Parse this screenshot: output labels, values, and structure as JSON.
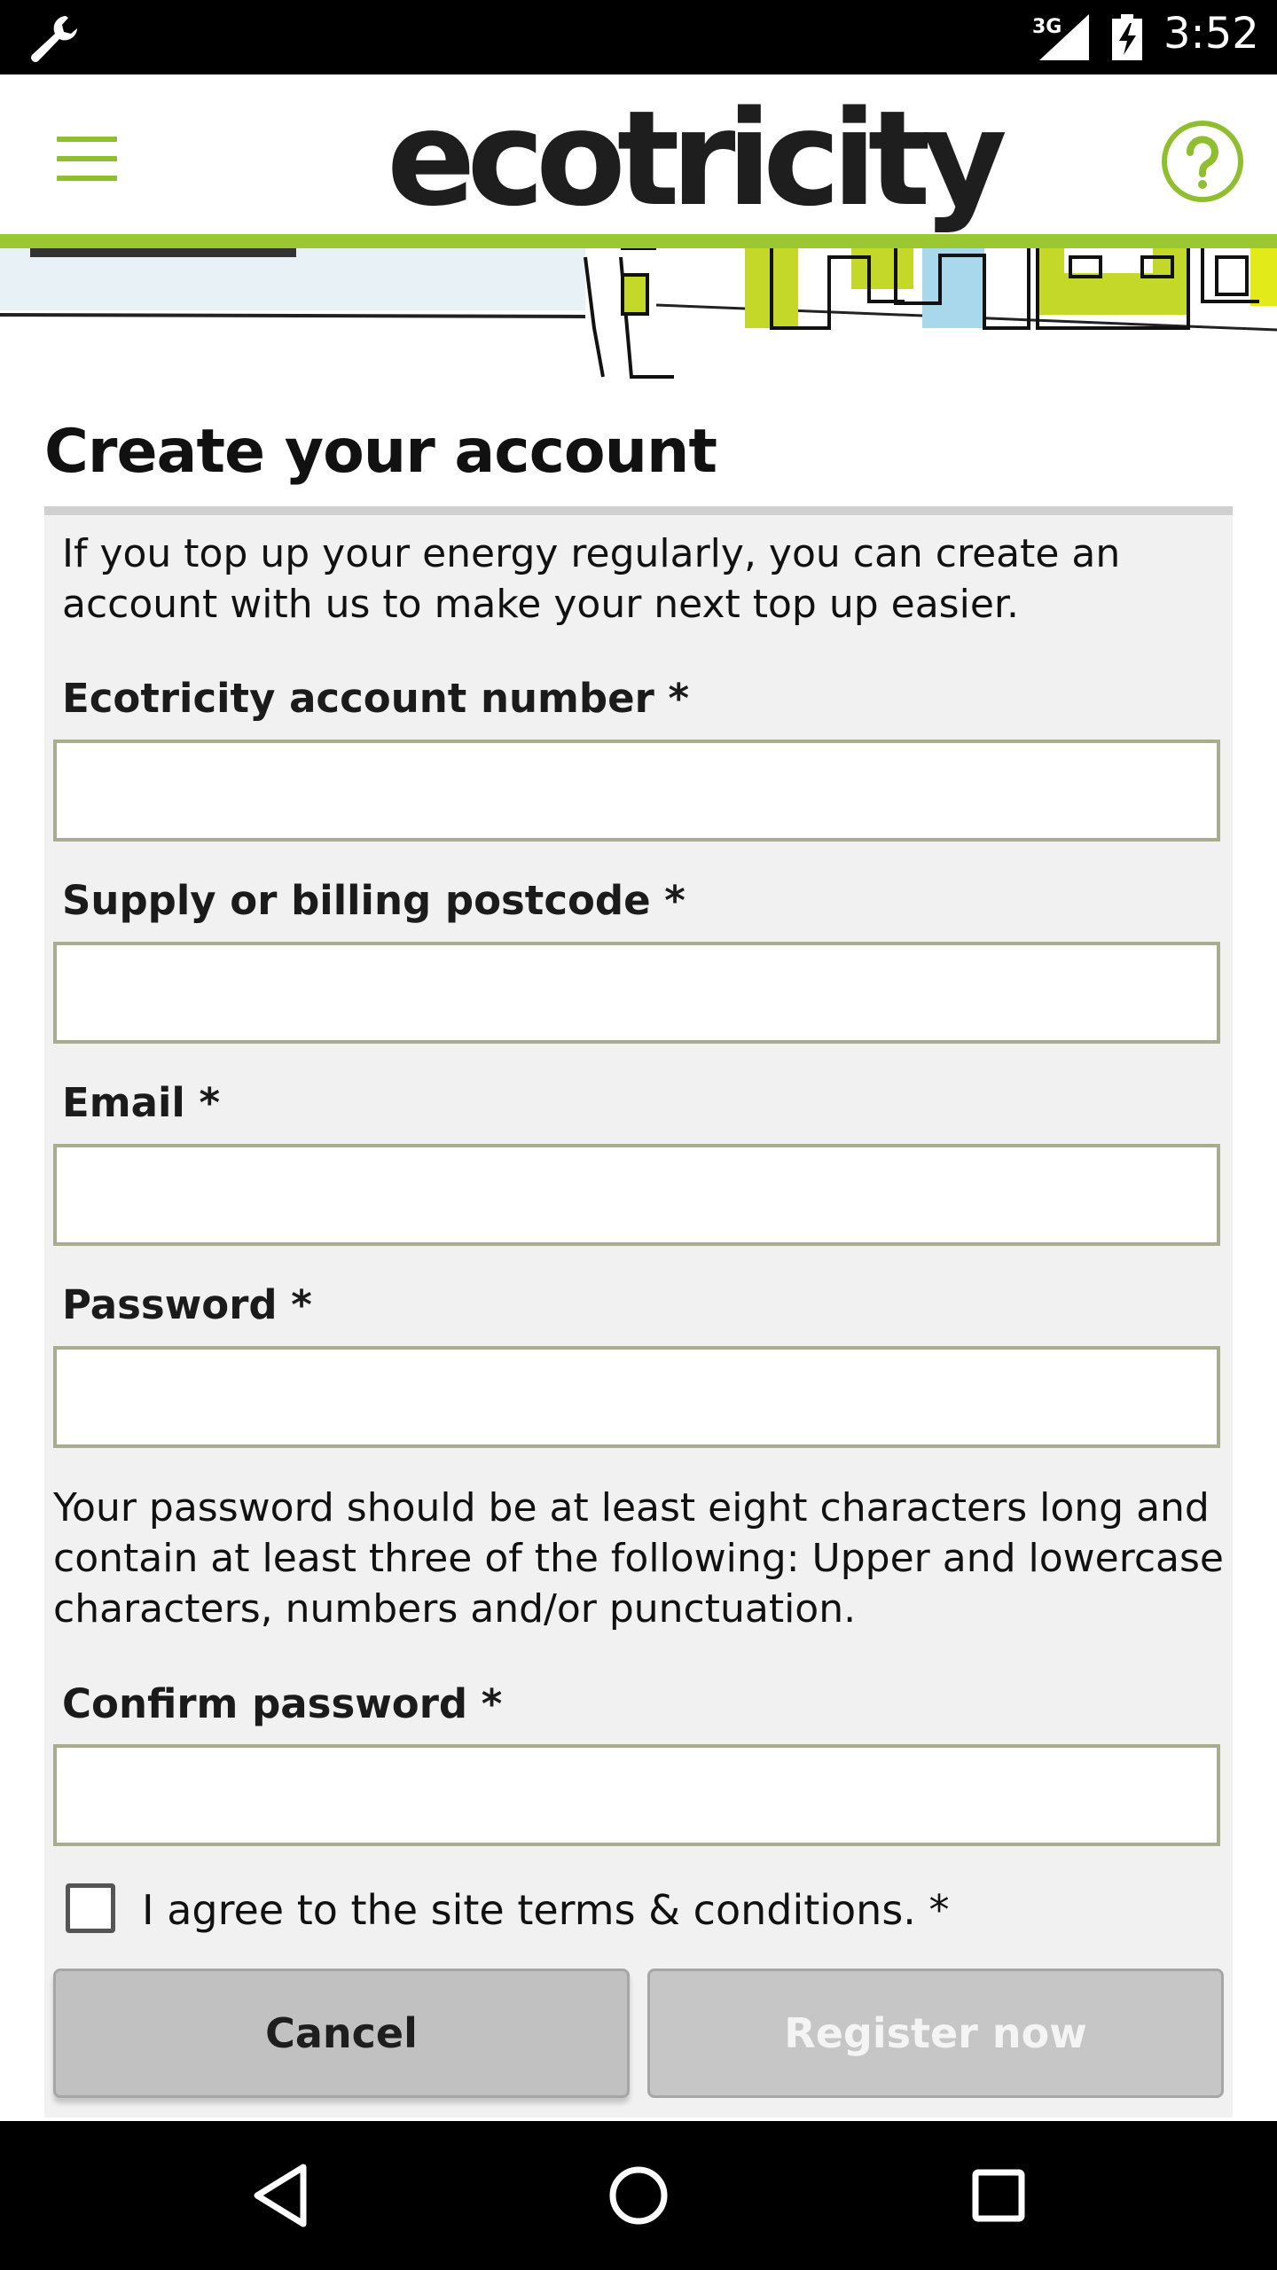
{
  "status_bar": {
    "network_type": "3G",
    "time": "3:52",
    "icons": [
      "wrench-icon",
      "signal-icon",
      "battery-charging-icon"
    ]
  },
  "header": {
    "logo_text": "ecotricity",
    "menu_icon": "hamburger-menu-icon",
    "help_icon": "help-circle-icon",
    "accent_color": "#9bc832"
  },
  "page": {
    "title": "Create your account",
    "intro": "If you top up your energy regularly, you can create an account with us to make your next top up easier."
  },
  "form": {
    "account_number": {
      "label": "Ecotricity account number *",
      "value": ""
    },
    "postcode": {
      "label": "Supply or billing postcode *",
      "value": ""
    },
    "email": {
      "label": "Email *",
      "value": ""
    },
    "password": {
      "label": "Password *",
      "value": ""
    },
    "password_help": "Your password should be at least eight characters long and contain at least three of the following: Upper and lowercase characters, numbers and/or punctuation.",
    "confirm_password": {
      "label": "Confirm password *",
      "value": ""
    },
    "terms_label": "I agree to the site terms & conditions. *",
    "terms_checked": false,
    "cancel_label": "Cancel",
    "register_label": "Register now"
  },
  "nav_bar": {
    "icons": [
      "back-icon",
      "home-icon",
      "recents-icon"
    ]
  }
}
